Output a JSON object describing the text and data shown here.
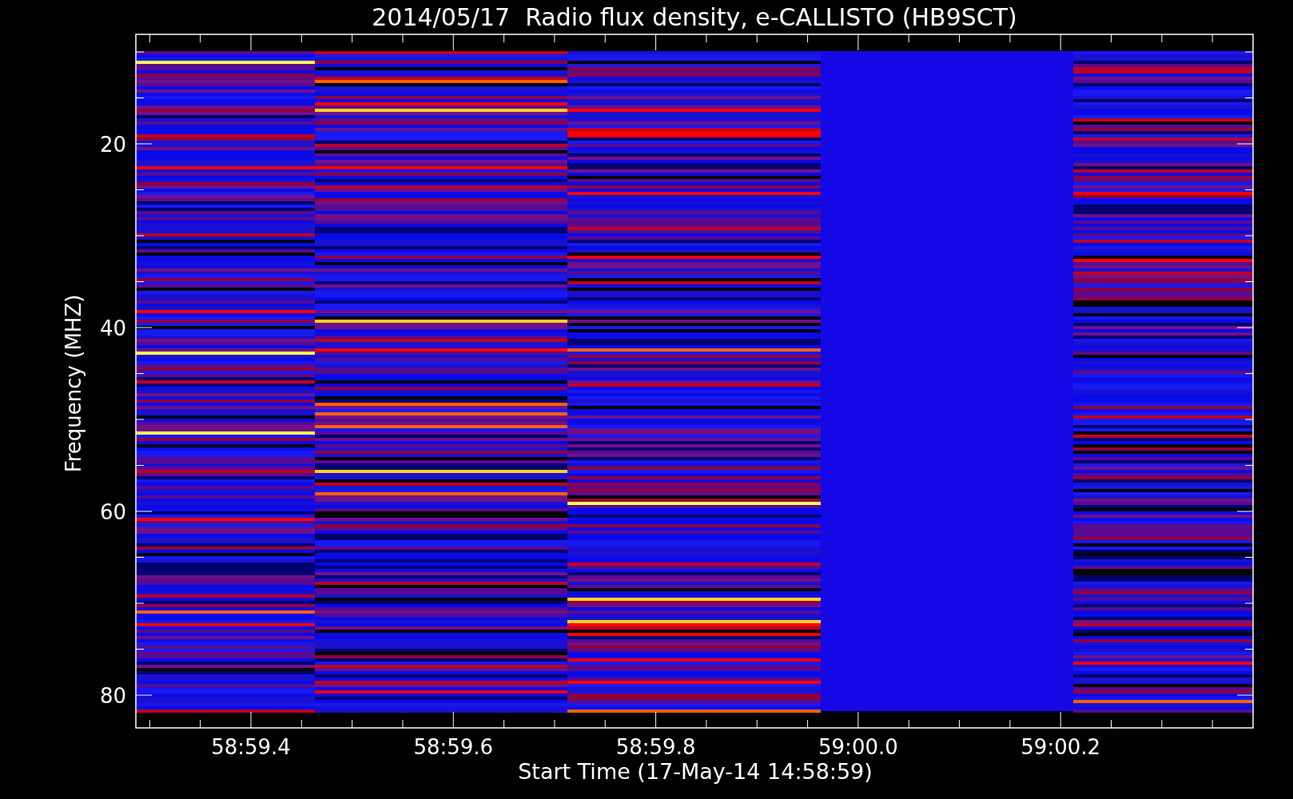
{
  "title": "2014/05/17  Radio flux density, e-CALLISTO (HB9SCT)",
  "y_axis": {
    "label": "Frequency (MHZ)",
    "ticks": [
      "20",
      "40",
      "60",
      "80"
    ]
  },
  "x_axis": {
    "label": "Start Time (17-May-14 14:58:59)",
    "ticks": [
      "58:59.4",
      "58:59.6",
      "58:59.8",
      "59:00.0",
      "59:00.2"
    ]
  }
}
